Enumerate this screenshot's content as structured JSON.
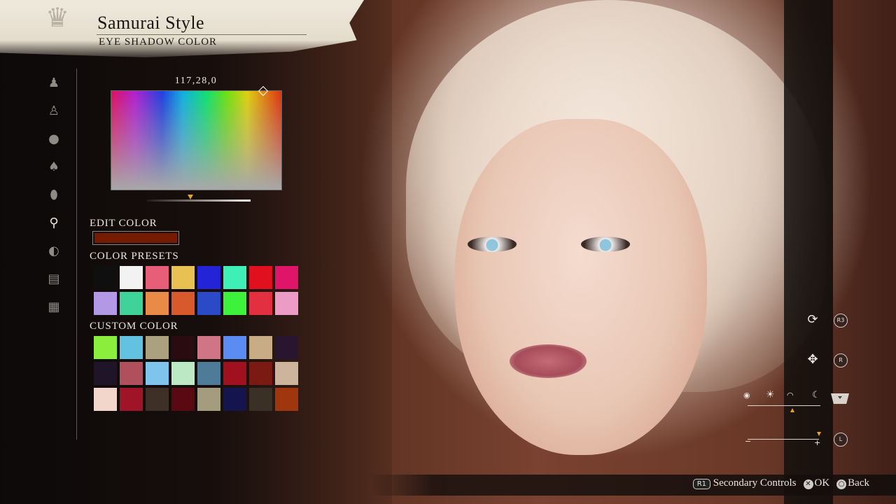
{
  "header": {
    "title": "Samurai Style",
    "subtitle": "EYE SHADOW COLOR"
  },
  "sidebar": {
    "items": [
      {
        "name": "body-icon",
        "glyph": "♟"
      },
      {
        "name": "figure-icon",
        "glyph": "♙"
      },
      {
        "name": "head-icon",
        "glyph": "●"
      },
      {
        "name": "hair-icon",
        "glyph": "♠"
      },
      {
        "name": "face-icon",
        "glyph": "⬮"
      },
      {
        "name": "makeup-icon",
        "glyph": "⚲"
      },
      {
        "name": "eyes-icon",
        "glyph": "◐"
      },
      {
        "name": "notes-icon",
        "glyph": "▤"
      },
      {
        "name": "grid-icon",
        "glyph": "▦"
      }
    ],
    "active_index": 5
  },
  "picker": {
    "rgb_value": "117,28,0",
    "brightness_level": 0.42
  },
  "edit": {
    "label": "EDIT COLOR",
    "current_color": "#751c00"
  },
  "presets": {
    "label": "COLOR PRESETS",
    "colors": [
      "#0f0f0f",
      "#f2f2f2",
      "#e85e78",
      "#e8c152",
      "#2323d8",
      "#3ef0b6",
      "#e0101e",
      "#e0156a",
      "#b398e6",
      "#3fd39a",
      "#e98b46",
      "#d85a2c",
      "#2a4ac8",
      "#3cf23a",
      "#e23040",
      "#ec9bc6"
    ]
  },
  "custom": {
    "label": "CUSTOM COLOR",
    "colors": [
      "#8cee3c",
      "#62c2df",
      "#aca17f",
      "#2a0c10",
      "#d07585",
      "#5a8cf4",
      "#c8ac86",
      "#2a1530",
      "#201528",
      "#b0505c",
      "#7ec4ec",
      "#bde8c4",
      "#4e7c98",
      "#a0101e",
      "#7a1a12",
      "#cdb49c",
      "#f2d6cc",
      "#a01428",
      "#3e3026",
      "#5a0812",
      "#a59c80",
      "#14154e",
      "#3a3026",
      "#a0360e"
    ]
  },
  "controls": {
    "camera_reset_icon": "camera-rotate-icon",
    "r3_label": "R3",
    "move_icon": "four-way-arrow-icon",
    "r_label": "R",
    "l_label": "L",
    "lighting_level": 0.62,
    "zoom_level": 1.0
  },
  "footer": {
    "r1_label": "R1",
    "secondary_label": "Secondary Controls",
    "ok_label": "OK",
    "back_label": "Back"
  }
}
